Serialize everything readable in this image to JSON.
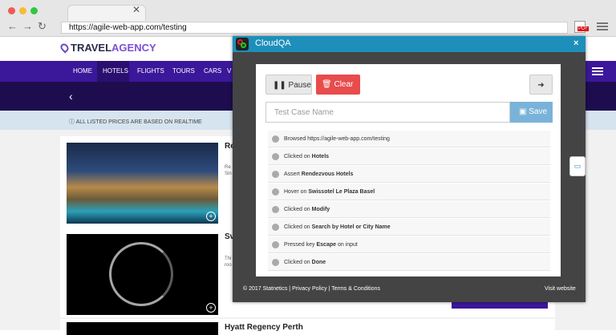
{
  "browser": {
    "url": "https://agile-web-app.com/testing",
    "pdf_icon_label": "PDF"
  },
  "site": {
    "logo": {
      "part1": "TRAVEL",
      "part2": "AGENCY"
    },
    "nav": [
      {
        "label": "HOME"
      },
      {
        "label": "HOTELS"
      },
      {
        "label": "FLIGHTS"
      },
      {
        "label": "TOURS"
      },
      {
        "label": "CARS"
      },
      {
        "label": "V"
      }
    ],
    "notice": "ALL LISTED PRICES ARE BASED ON REALTIME",
    "cards": [
      {
        "title": "Re",
        "snippet": "Re",
        "snippet2": "Sin"
      },
      {
        "title": "Sv",
        "snippet": "Thi",
        "snippet2": "roo"
      },
      {
        "title": "Hyatt Regency Perth"
      }
    ]
  },
  "cloudqa": {
    "title": "CloudQA",
    "close": "×",
    "pause_label": "Pause",
    "clear_label": "Clear",
    "testcase_placeholder": "Test Case Name",
    "save_label": "Save",
    "steps": [
      {
        "action": "Browsed",
        "target": "https://agile-web-app.com/testing",
        "suffix": "",
        "bold": false
      },
      {
        "action": "Clicked on",
        "target": "Hotels",
        "suffix": "",
        "bold": true
      },
      {
        "action": "Assert",
        "target": "Rendezvous Hotels",
        "suffix": "",
        "bold": true
      },
      {
        "action": "Hover on",
        "target": "Swissotel Le Plaza Basel",
        "suffix": "",
        "bold": true
      },
      {
        "action": "Clicked on",
        "target": "Modify",
        "suffix": "",
        "bold": true
      },
      {
        "action": "Clicked on",
        "target": "Search by Hotel or City Name",
        "suffix": "",
        "bold": true
      },
      {
        "action": "Pressed key",
        "target": "Escape",
        "suffix": "on input",
        "bold": true
      },
      {
        "action": "Clicked on",
        "target": "Done",
        "suffix": "",
        "bold": true
      }
    ],
    "footer": {
      "copyright": "© 2017 Statnetics",
      "privacy": "Privacy Policy",
      "terms": "Terms & Conditions",
      "visit": "Visit website"
    }
  },
  "colors": {
    "nav_purple": "#3b179a",
    "cloudqa_blue": "#1e8fba",
    "clear_red": "#e84c4c"
  }
}
